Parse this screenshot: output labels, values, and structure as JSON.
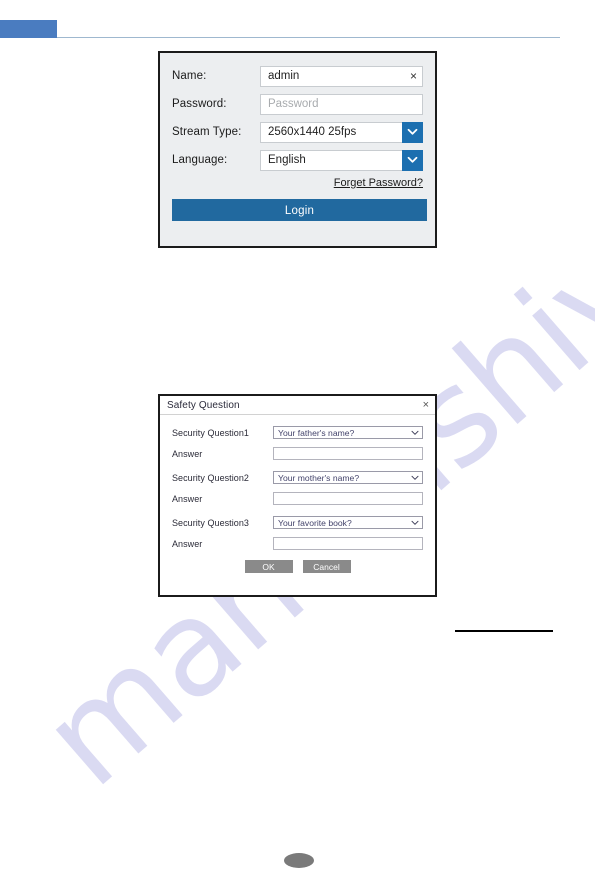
{
  "page": {
    "header_tab_color": "#4a7cc0",
    "rule_color": "#9fb8cf",
    "watermark": "manualshive.com",
    "page_number": ""
  },
  "login_dialog": {
    "name": {
      "label": "Name:",
      "value": "admin",
      "clear_icon": "×"
    },
    "password": {
      "label": "Password:",
      "value": "",
      "placeholder": "Password"
    },
    "stream_type": {
      "label": "Stream Type:",
      "value": "2560x1440 25fps",
      "dropdown_icon": "chevron-down-icon"
    },
    "language": {
      "label": "Language:",
      "value": "English",
      "dropdown_icon": "chevron-down-icon"
    },
    "forget_password_link": "Forget Password?",
    "login_button": "Login",
    "accent_color": "#21699f"
  },
  "safety_question_dialog": {
    "title": "Safety Question",
    "close_icon": "×",
    "groups": [
      {
        "question_label": "Security Question1",
        "question_value": "Your father's name?",
        "answer_label": "Answer",
        "answer_value": ""
      },
      {
        "question_label": "Security Question2",
        "question_value": "Your mother's name?",
        "answer_label": "Answer",
        "answer_value": ""
      },
      {
        "question_label": "Security Question3",
        "question_value": "Your favorite book?",
        "answer_label": "Answer",
        "answer_value": ""
      }
    ],
    "ok_button": "OK",
    "cancel_button": "Cancel"
  }
}
